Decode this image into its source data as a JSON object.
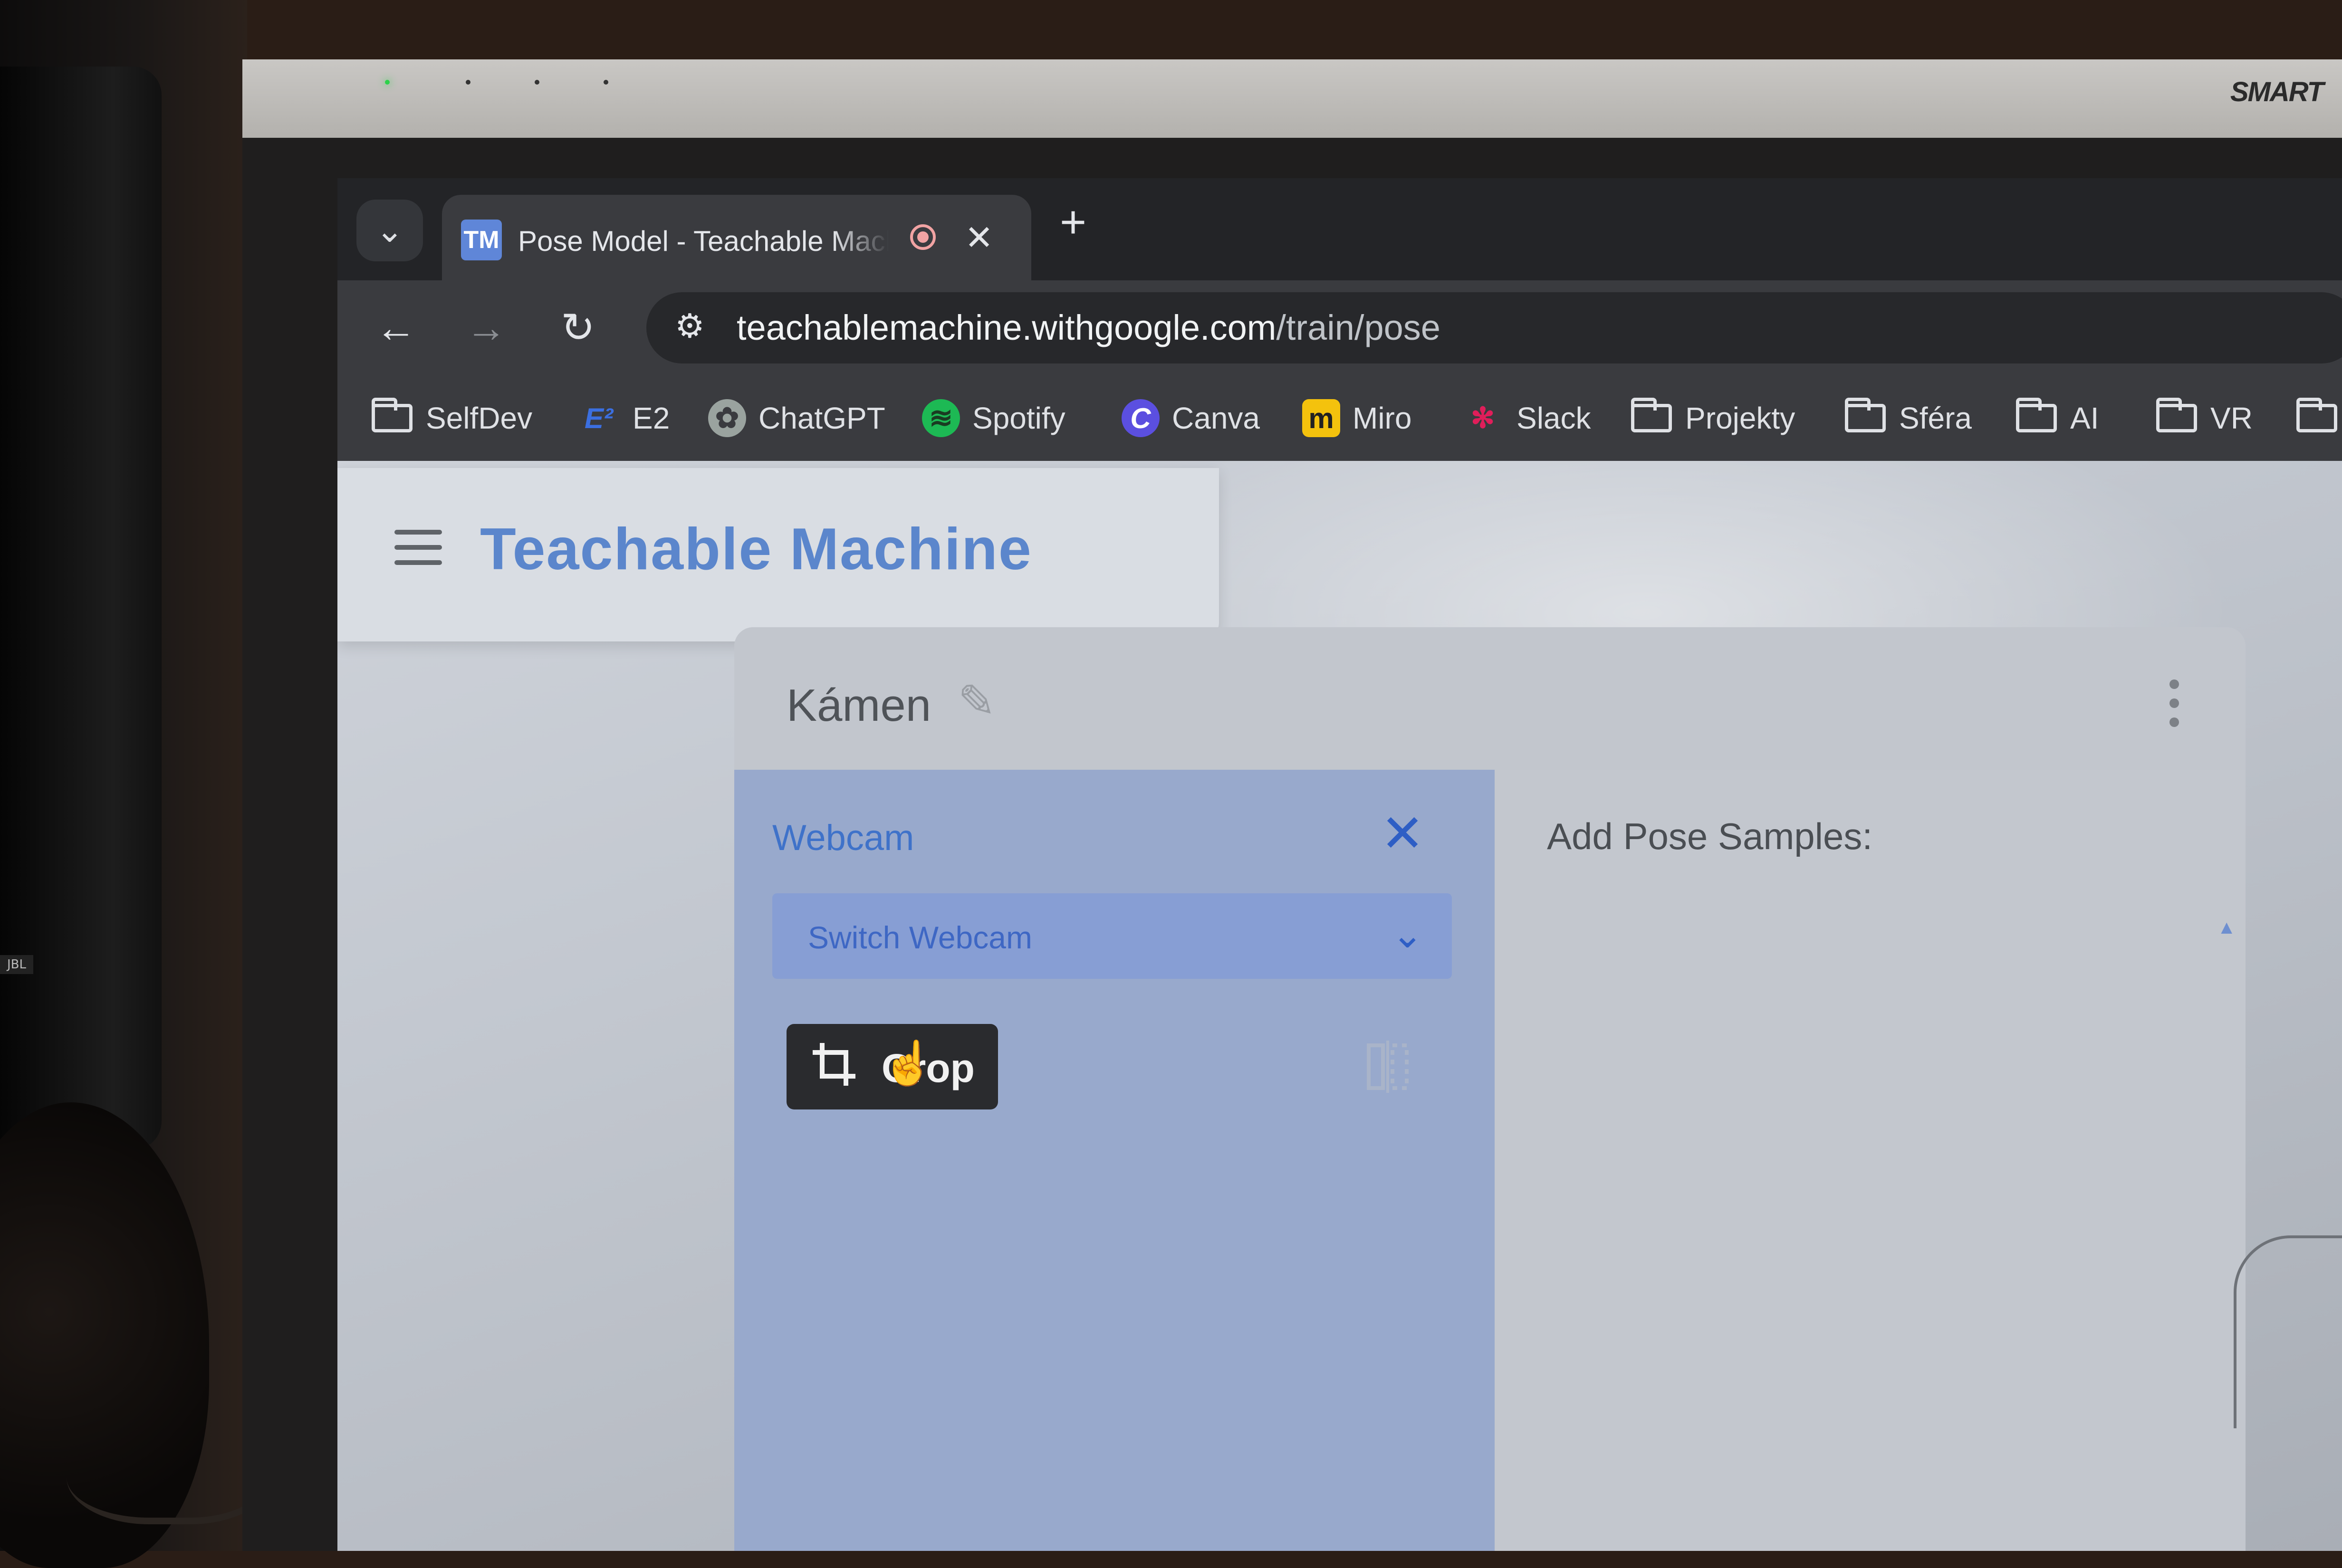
{
  "tv": {
    "brand": "SMART"
  },
  "speaker": {
    "logo": "JBL"
  },
  "browser": {
    "tab": {
      "logo_text": "TM",
      "title": "Pose Model - Teachable Machine"
    },
    "url": {
      "domain": "teachablemachine.withgoogle.com",
      "path": "/train/pose"
    },
    "bookmarks": [
      {
        "label": "SelfDev",
        "icon": "folder-icon"
      },
      {
        "label": "E2",
        "icon": "e2-logo-icon",
        "glyph": "E²",
        "color": "#3b6fe0"
      },
      {
        "label": "ChatGPT",
        "icon": "chatgpt-logo-icon",
        "glyph": "✿",
        "color": "#9aa39f"
      },
      {
        "label": "Spotify",
        "icon": "spotify-logo-icon",
        "glyph": "≋",
        "color": "#1db954"
      },
      {
        "label": "Canva",
        "icon": "canva-logo-icon",
        "glyph": "C",
        "color": "#5b4fe0"
      },
      {
        "label": "Miro",
        "icon": "miro-logo-icon",
        "glyph": "m",
        "color": "#f4c20d"
      },
      {
        "label": "Slack",
        "icon": "slack-logo-icon",
        "glyph": "✻",
        "color": "#e01e5a"
      },
      {
        "label": "Projekty",
        "icon": "folder-icon"
      },
      {
        "label": "Sféra",
        "icon": "folder-icon"
      },
      {
        "label": "AI",
        "icon": "folder-icon"
      },
      {
        "label": "VR",
        "icon": "folder-icon"
      }
    ]
  },
  "app": {
    "title": "Teachable Machine",
    "class_card": {
      "name": "Kámen",
      "webcam_label": "Webcam",
      "switch_webcam": "Switch Webcam",
      "crop_button": "Crop",
      "samples_title": "Add Pose Samples:"
    }
  },
  "colors": {
    "accent": "#3f72c9",
    "brand_title": "#5b86cc",
    "webcam_panel": "#98a9cc"
  }
}
